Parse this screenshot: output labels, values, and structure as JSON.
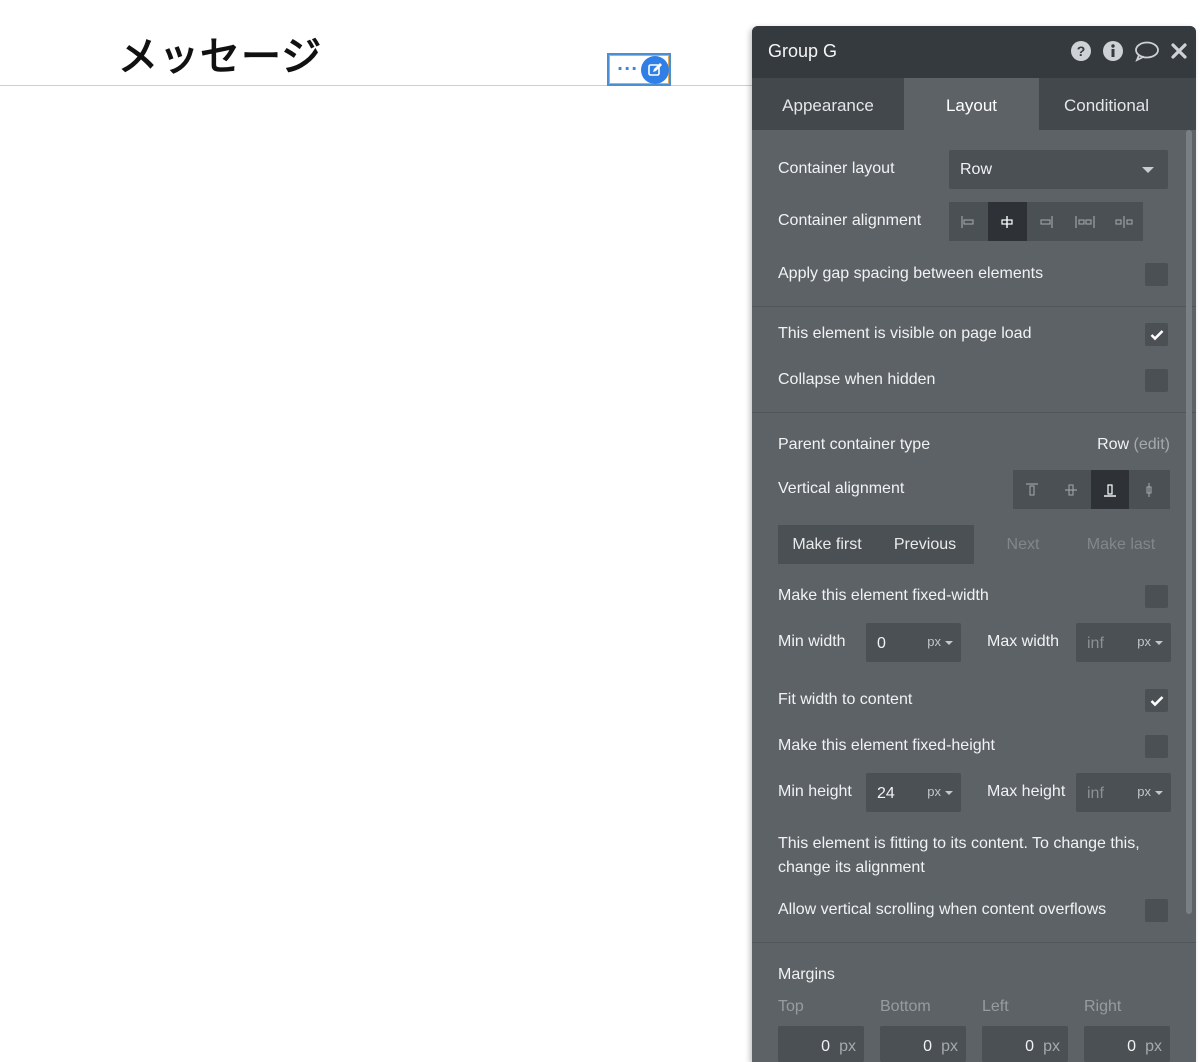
{
  "page": {
    "title": "メッセージ",
    "selection_dots": "···"
  },
  "panel": {
    "title": "Group G",
    "tabs": [
      "Appearance",
      "Layout",
      "Conditional"
    ],
    "active_tab": "Layout",
    "container_layout": {
      "label": "Container layout",
      "value": "Row"
    },
    "container_alignment": {
      "label": "Container alignment",
      "selected_index": 1
    },
    "gap_spacing": {
      "label": "Apply gap spacing between elements",
      "checked": false
    },
    "visible_on_load": {
      "label": "This element is visible on page load",
      "checked": true
    },
    "collapse_hidden": {
      "label": "Collapse when hidden",
      "checked": false
    },
    "parent_container": {
      "label": "Parent container type",
      "value": "Row",
      "edit": "(edit)"
    },
    "vertical_alignment": {
      "label": "Vertical alignment",
      "selected_index": 2
    },
    "order_buttons": {
      "make_first": "Make first",
      "previous": "Previous",
      "next": "Next",
      "make_last": "Make last"
    },
    "fixed_width": {
      "label": "Make this element fixed-width",
      "checked": false
    },
    "min_width": {
      "label": "Min width",
      "value": "0",
      "unit": "px"
    },
    "max_width": {
      "label": "Max width",
      "value": "inf",
      "unit": "px"
    },
    "fit_width": {
      "label": "Fit width to content",
      "checked": true
    },
    "fixed_height": {
      "label": "Make this element fixed-height",
      "checked": false
    },
    "min_height": {
      "label": "Min height",
      "value": "24",
      "unit": "px"
    },
    "max_height": {
      "label": "Max height",
      "value": "inf",
      "unit": "px"
    },
    "fitting_note": "This element is fitting to its content. To change this, change its alignment",
    "vertical_scroll": {
      "label": "Allow vertical scrolling when content overflows",
      "checked": false
    },
    "margins": {
      "label": "Margins",
      "top": {
        "label": "Top",
        "value": "0",
        "unit": "px"
      },
      "bottom": {
        "label": "Bottom",
        "value": "0",
        "unit": "px"
      },
      "left": {
        "label": "Left",
        "value": "0",
        "unit": "px"
      },
      "right": {
        "label": "Right",
        "value": "0",
        "unit": "px"
      }
    },
    "icons": [
      "help-icon",
      "info-icon",
      "comment-icon",
      "close-icon"
    ]
  }
}
